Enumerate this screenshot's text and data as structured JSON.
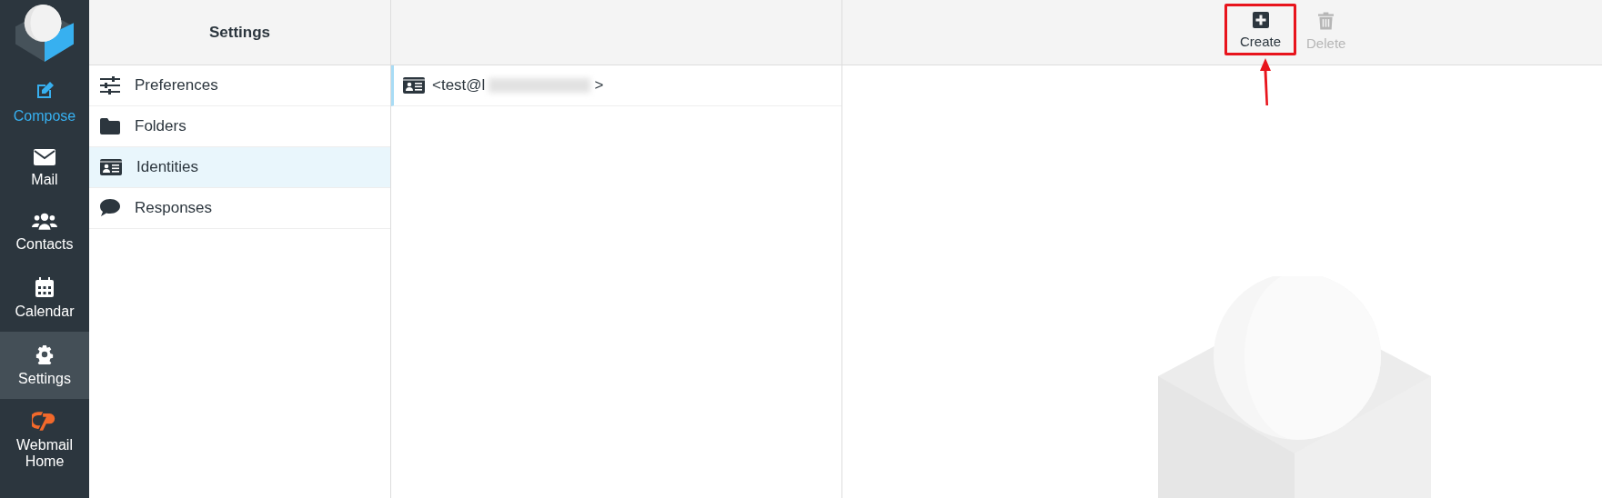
{
  "nav": [
    {
      "label": "Compose",
      "kind": "accent",
      "selected": false
    },
    {
      "label": "Mail",
      "kind": "plain",
      "selected": false
    },
    {
      "label": "Contacts",
      "kind": "plain",
      "selected": false
    },
    {
      "label": "Calendar",
      "kind": "plain",
      "selected": false
    },
    {
      "label": "Settings",
      "kind": "plain",
      "selected": true
    },
    {
      "label": "Webmail Home",
      "kind": "brand",
      "selected": false
    }
  ],
  "settings": {
    "title": "Settings",
    "items": [
      {
        "label": "Preferences",
        "selected": false
      },
      {
        "label": "Folders",
        "selected": false
      },
      {
        "label": "Identities",
        "selected": true
      },
      {
        "label": "Responses",
        "selected": false
      }
    ]
  },
  "identities": [
    {
      "start": "<test@l",
      "end": ">",
      "redacted": true,
      "selected": true
    }
  ],
  "toolbar": [
    {
      "label": "Create",
      "kind": "create",
      "disabled": false,
      "highlighted": true
    },
    {
      "label": "Delete",
      "kind": "delete",
      "disabled": true,
      "highlighted": false
    }
  ]
}
